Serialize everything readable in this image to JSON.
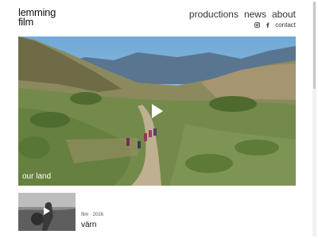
{
  "brand": {
    "line1": "lemming",
    "line2": "film"
  },
  "nav": {
    "productions": "productions",
    "news": "news",
    "about": "about"
  },
  "subnav": {
    "instagram_icon": "instagram-icon",
    "facebook_icon": "facebook-icon",
    "contact": "contact"
  },
  "hero": {
    "caption": "our land",
    "play_icon": "play-icon"
  },
  "cards": [
    {
      "meta": "film · 2026",
      "title": "värn",
      "play_icon": "play-icon"
    }
  ],
  "colors": {
    "text": "#111111",
    "background": "#ffffff",
    "sky": "#7fb4d9"
  }
}
